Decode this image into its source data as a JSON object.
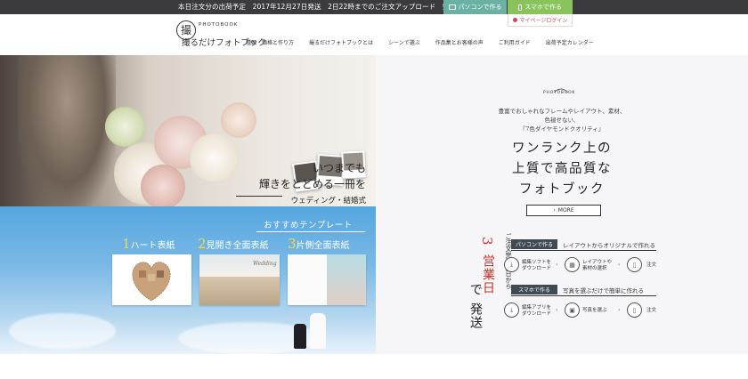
{
  "topbar": {
    "notice": "本日注文分の出荷予定　2017年12月27日発送　2日22時までのご注文アップロード　完了分",
    "pc_button": "パソコンで作る",
    "sp_button": "スマホで作る",
    "login": "マイページログイン"
  },
  "header": {
    "logo_sub": "PHOTOBOOK",
    "logo_main": "撮るだけフォトブック",
    "logo_mark": "撮",
    "nav": [
      "種類・価格と作り方",
      "撮るだけフォトブックとは",
      "シーンで選ぶ",
      "作品集とお客様の声",
      "ご利用ガイド",
      "出荷予定カレンダー"
    ]
  },
  "hero": {
    "line1": "いつまでも",
    "line2": "輝きをとどめる一冊を",
    "line3": "ウェディング・結婚式"
  },
  "promo": {
    "logo_text": "PHOTOBOOK",
    "desc": [
      "豊富でおしゃれなフレームやレイアウト、素材、",
      "色褪せない、",
      "『7色ダイヤモンドクオリティ』"
    ],
    "catch": [
      "ワンランク上の",
      "上質で高品質な",
      "フォトブック"
    ],
    "more_label": "MORE",
    "more_arrow": "›"
  },
  "shipping": {
    "note": "ご注文完了翌日から",
    "number": "3",
    "unit": "営業日",
    "de": "で",
    "hasso": "発送"
  },
  "modes": [
    {
      "tag": "パソコンで作る",
      "desc": "レイアウトからオリジナルで作れる",
      "steps": [
        {
          "icon": "download-icon",
          "glyph": "⤓",
          "label": "編集ソフトを\nダウンロード"
        },
        {
          "icon": "layout-icon",
          "glyph": "▦",
          "label": "レイアウトや\n素材の選択"
        },
        {
          "icon": "book-icon",
          "glyph": "▯",
          "label": "注文"
        }
      ]
    },
    {
      "tag": "スマホで作る",
      "desc": "写真を選ぶだけで簡単に作れる",
      "steps": [
        {
          "icon": "download-icon",
          "glyph": "⤓",
          "label": "編集アプリを\nダウンロード"
        },
        {
          "icon": "photo-icon",
          "glyph": "▣",
          "label": "写真を選ぶ"
        },
        {
          "icon": "book-icon",
          "glyph": "▯",
          "label": "注文"
        }
      ]
    }
  ],
  "templates": {
    "title": "おすすめテンプレート",
    "items": [
      {
        "num": "1",
        "name": "ハート表紙"
      },
      {
        "num": "2",
        "name": "見開き全面表紙"
      },
      {
        "num": "3",
        "name": "片側全面表紙"
      }
    ],
    "card2_script": "Wedding"
  },
  "colors": {
    "topbar": "#3b3a3f",
    "pc_button": "#6ab1a4",
    "sp_button": "#8ac25c",
    "accent_red": "#c0312b",
    "template_num": "#f5d74a"
  }
}
